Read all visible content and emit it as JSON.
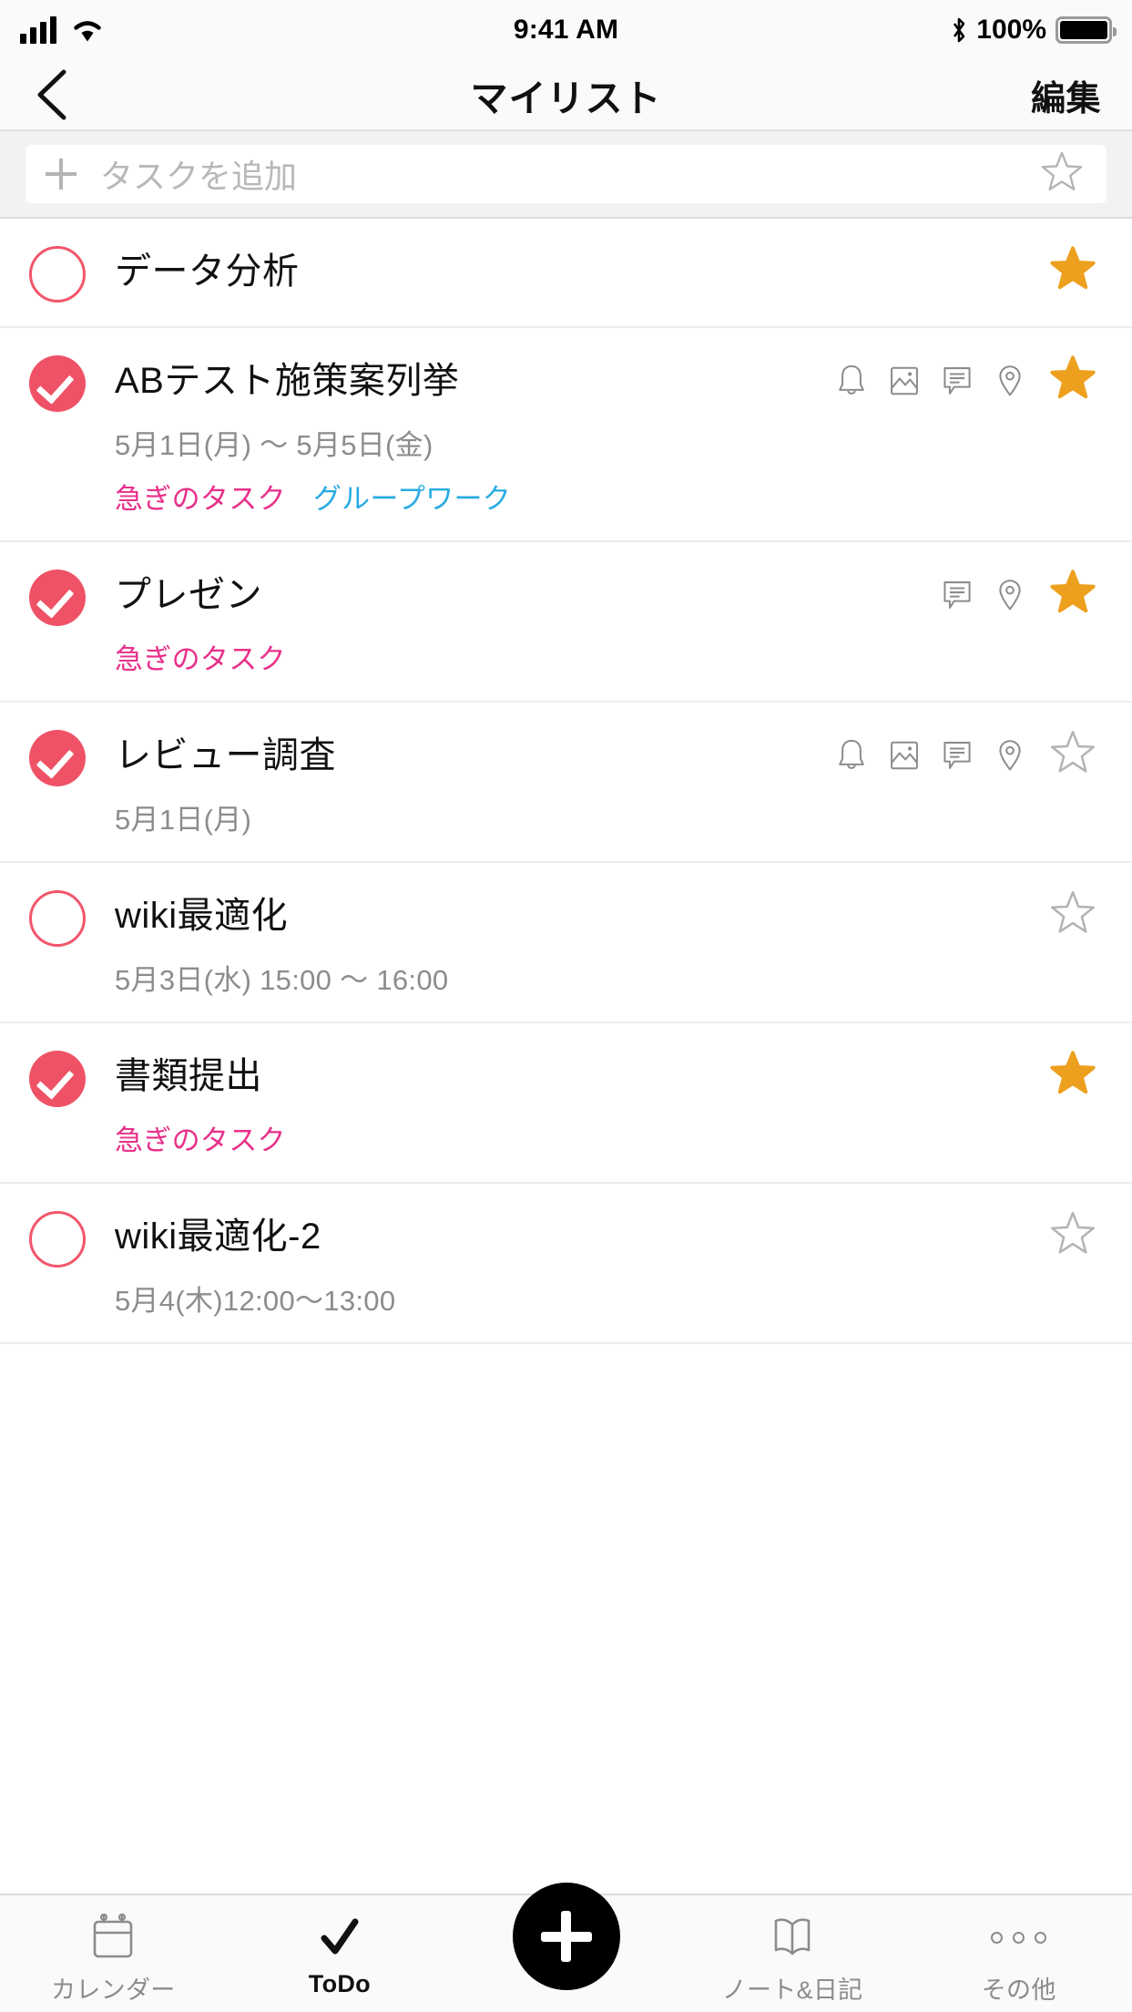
{
  "status_bar": {
    "time": "9:41 AM",
    "battery_percent": "100%",
    "signal_icon": "cellular-signal-icon",
    "wifi_icon": "wifi-icon",
    "bluetooth_icon": "bluetooth-icon",
    "battery_icon": "battery-full-icon"
  },
  "nav": {
    "back_icon": "chevron-left-icon",
    "title": "マイリスト",
    "edit_label": "編集"
  },
  "add_task": {
    "plus_icon": "plus-icon",
    "placeholder": "タスクを追加",
    "star_icon": "star-outline-icon"
  },
  "colors": {
    "accent_pink": "#ef5266",
    "star_gold": "#eda01e",
    "tag_urgent": "#e8308a",
    "tag_group": "#29abe2",
    "icon_gray": "#8c8c8c"
  },
  "tasks": [
    {
      "title": "データ分析",
      "done": false,
      "date": "",
      "tags": [],
      "icons": [],
      "starred": true
    },
    {
      "title": "ABテスト施策案列挙",
      "done": true,
      "date": "5月1日(月) 〜 5月5日(金)",
      "tags": [
        {
          "label": "急ぎのタスク",
          "color": "#e8308a"
        },
        {
          "label": "グループワーク",
          "color": "#29abe2"
        }
      ],
      "icons": [
        "bell-icon",
        "image-icon",
        "comment-icon",
        "location-pin-icon"
      ],
      "starred": true
    },
    {
      "title": "プレゼン",
      "done": true,
      "date": "",
      "tags": [
        {
          "label": "急ぎのタスク",
          "color": "#e8308a"
        }
      ],
      "icons": [
        "comment-icon",
        "location-pin-icon"
      ],
      "starred": true
    },
    {
      "title": "レビュー調査",
      "done": true,
      "date": "5月1日(月)",
      "tags": [],
      "icons": [
        "bell-icon",
        "image-icon",
        "comment-icon",
        "location-pin-icon"
      ],
      "starred": false
    },
    {
      "title": "wiki最適化",
      "done": false,
      "date": "5月3日(水) 15:00 〜 16:00",
      "tags": [],
      "icons": [],
      "starred": false
    },
    {
      "title": "書類提出",
      "done": true,
      "date": "",
      "tags": [
        {
          "label": "急ぎのタスク",
          "color": "#e8308a"
        }
      ],
      "icons": [],
      "starred": true
    },
    {
      "title": "wiki最適化-2",
      "done": false,
      "date": "5月4(木)12:00〜13:00",
      "tags": [],
      "icons": [],
      "starred": false
    }
  ],
  "tab_bar": {
    "items": [
      {
        "label": "カレンダー",
        "icon": "calendar-icon",
        "active": false
      },
      {
        "label": "ToDo",
        "icon": "checkmark-icon",
        "active": true
      },
      {
        "label": "",
        "icon": "add-fab-icon",
        "active": false
      },
      {
        "label": "ノート&日記",
        "icon": "book-icon",
        "active": false
      },
      {
        "label": "その他",
        "icon": "more-dots-icon",
        "active": false
      }
    ]
  }
}
